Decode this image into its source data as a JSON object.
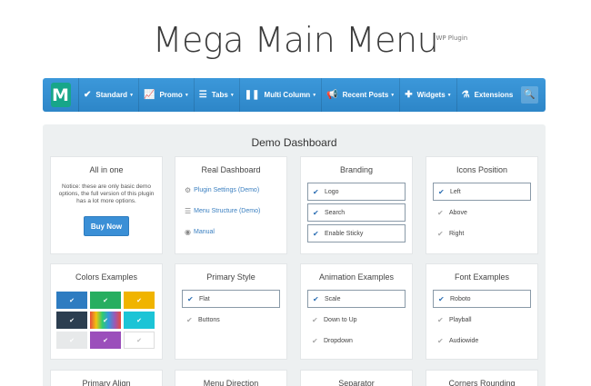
{
  "header": {
    "title": "Mega Main Menu",
    "superscript": "WP Plugin"
  },
  "menubar": {
    "logo_letter": "M",
    "items": [
      {
        "label": "Standard",
        "icon": "check-icon"
      },
      {
        "label": "Promo",
        "icon": "chart-icon"
      },
      {
        "label": "Tabs",
        "icon": "list-icon"
      },
      {
        "label": "Multi Column",
        "icon": "columns-icon"
      },
      {
        "label": "Recent Posts",
        "icon": "megaphone-icon"
      },
      {
        "label": "Widgets",
        "icon": "puzzle-icon"
      },
      {
        "label": "Extensions",
        "icon": "flask-icon"
      }
    ],
    "search_icon": "search-icon",
    "colors": {
      "bar": "#3393d4",
      "logo": "#17a689"
    }
  },
  "dashboard": {
    "title": "Demo Dashboard",
    "all_in_one": {
      "title": "All in one",
      "notice": "Notice: these are only basic demo options, the full version of this plugin has a lot more options.",
      "button": "Buy Now"
    },
    "real_dashboard": {
      "title": "Real Dashboard",
      "links": [
        "Plugin Settings (Demo)",
        "Menu Structure (Demo)",
        "Manual"
      ]
    },
    "branding": {
      "title": "Branding",
      "options": [
        "Logo",
        "Search",
        "Enable Sticky"
      ]
    },
    "icons_position": {
      "title": "Icons Position",
      "options": [
        "Left",
        "Above",
        "Right"
      ]
    },
    "colors_examples": {
      "title": "Colors Examples",
      "swatches": [
        "#2e7cc1",
        "#27ae60",
        "#f0b400",
        "#2c3e50",
        "rainbow",
        "#1cc4d6",
        "#e7e9ea",
        "#9b4fbb",
        "#ffffff"
      ]
    },
    "primary_style": {
      "title": "Primary Style",
      "options": [
        "Flat",
        "Buttons"
      ]
    },
    "animation_examples": {
      "title": "Animation Examples",
      "options": [
        "Scale",
        "Down to Up",
        "Dropdown"
      ]
    },
    "font_examples": {
      "title": "Font Examples",
      "options": [
        "Roboto",
        "Playball",
        "Audiowide"
      ]
    },
    "bottom_row": [
      "Primary Align",
      "Menu Direction",
      "Separator",
      "Corners Rounding"
    ]
  }
}
